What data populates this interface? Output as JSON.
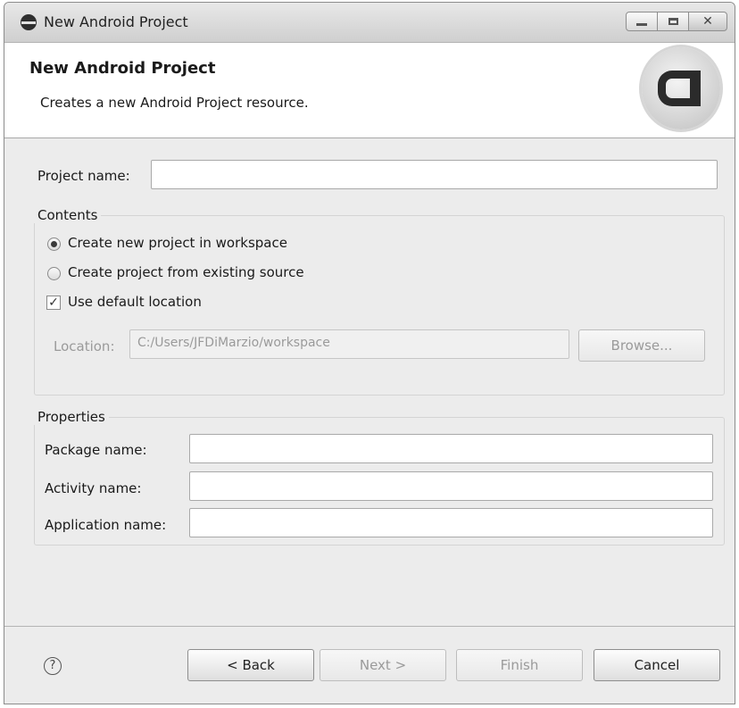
{
  "window": {
    "title": "New Android Project",
    "minimize_icon": "minimize-icon",
    "maximize_icon": "maximize-icon",
    "close_glyph": "✕"
  },
  "header": {
    "title": "New Android Project",
    "description": "Creates a new Android Project resource.",
    "logo_icon": "android-logo-icon"
  },
  "project_name": {
    "label": "Project name:",
    "value": ""
  },
  "contents": {
    "title": "Contents",
    "options": [
      {
        "label": "Create new project in workspace",
        "selected": true
      },
      {
        "label": "Create project from existing source",
        "selected": false
      }
    ],
    "use_default_location": {
      "label": "Use default location",
      "checked": true,
      "check_glyph": "✓"
    },
    "location": {
      "label": "Location:",
      "value": "C:/Users/JFDiMarzio/workspace",
      "enabled": false
    },
    "browse_label": "Browse..."
  },
  "properties": {
    "title": "Properties",
    "fields": [
      {
        "label": "Package name:",
        "value": ""
      },
      {
        "label": "Activity name:",
        "value": ""
      },
      {
        "label": "Application name:",
        "value": ""
      }
    ]
  },
  "footer": {
    "help_glyph": "?",
    "back_label": "< Back",
    "next_label": "Next >",
    "finish_label": "Finish",
    "cancel_label": "Cancel"
  },
  "colors": {
    "window_bg": "#ececec",
    "header_bg": "#ffffff",
    "disabled_text": "#9a9a9a"
  }
}
